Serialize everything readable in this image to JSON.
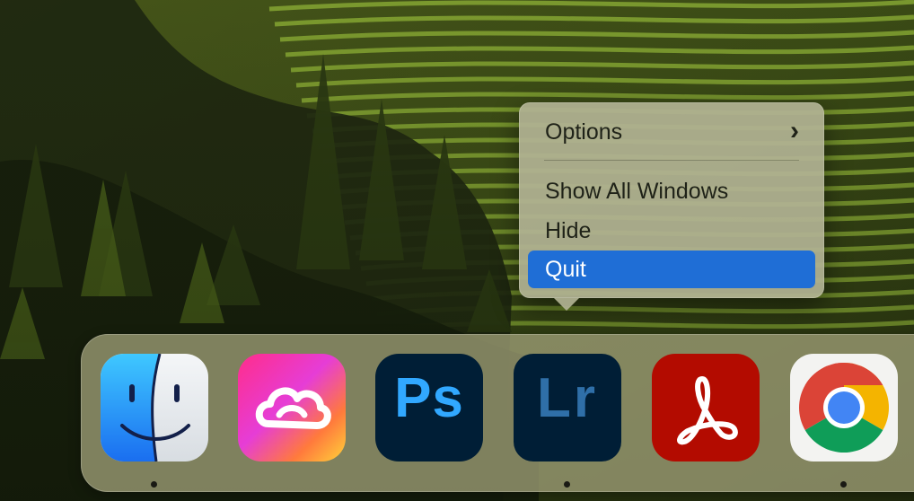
{
  "context_menu": {
    "items": [
      {
        "label": "Options",
        "has_submenu": true
      },
      {
        "label": "Show All Windows",
        "has_submenu": false
      },
      {
        "label": "Hide",
        "has_submenu": false
      },
      {
        "label": "Quit",
        "has_submenu": false,
        "selected": true
      }
    ],
    "selection_color": "#1f6ed6"
  },
  "dock": {
    "apps": [
      {
        "name": "Finder",
        "icon": "finder-icon",
        "running": true
      },
      {
        "name": "Adobe Creative Cloud",
        "icon": "creative-cloud-icon",
        "running": false
      },
      {
        "name": "Adobe Photoshop",
        "icon": "photoshop-icon",
        "icon_text": "Ps",
        "running": false
      },
      {
        "name": "Adobe Lightroom",
        "icon": "lightroom-icon",
        "icon_text": "Lr",
        "running": true
      },
      {
        "name": "Adobe Acrobat",
        "icon": "acrobat-icon",
        "running": false
      },
      {
        "name": "Google Chrome",
        "icon": "chrome-icon",
        "running": true
      }
    ]
  },
  "wallpaper": {
    "subject": "forested hillside with terraced vineyard rows",
    "dominant_colors": [
      "#2d3a12",
      "#5d7a1c",
      "#8a9a3a"
    ]
  }
}
